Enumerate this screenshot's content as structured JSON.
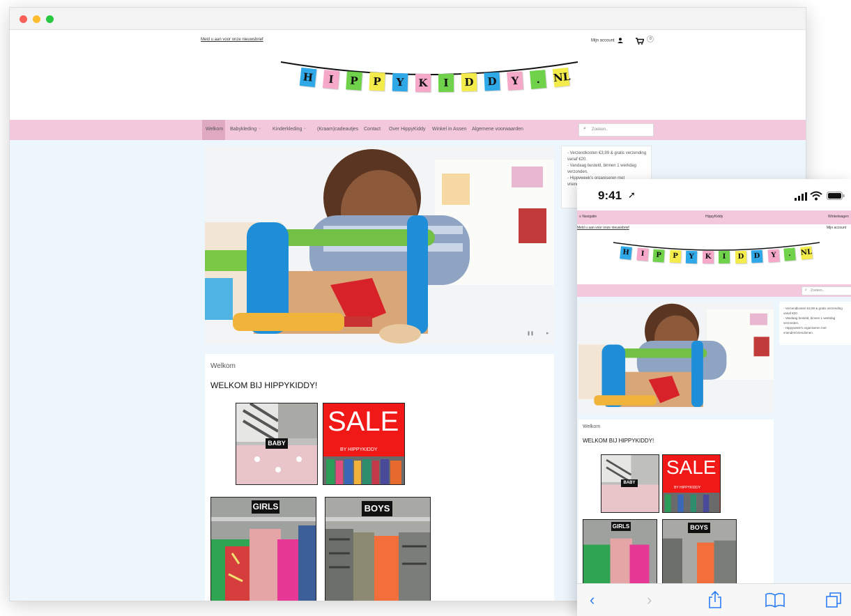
{
  "desktop": {
    "newsletter_link": "Meld u aan voor onze nieuwsbrief",
    "account_label": "Mijn account",
    "cart_count": "0",
    "logo_letters": [
      "H",
      "I",
      "P",
      "P",
      "Y",
      "K",
      "I",
      "D",
      "D",
      "Y",
      ".",
      "NL"
    ],
    "nav": {
      "items": [
        "Welkom",
        "Babykleding",
        "Kinderkleding",
        "(Kraam)cadeautjes",
        "Contact",
        "Over HippyKiddy",
        "Winkel in Assen",
        "Algemene voorwaarden"
      ],
      "active": "Welkom"
    },
    "search_placeholder": "Zoeken..",
    "info_box": [
      "- Verzendkosten €3,99 & gratis verzending vanaf €20.",
      "- Vandaag besteld, binnen 1 werkdag verzonden.",
      "- Hippyweek's organiseren met vrienden/vriendinnen."
    ],
    "content": {
      "breadcrumb": "Welkom",
      "heading": "WELKOM BIJ HIPPYKIDDY!",
      "tiles": [
        "BABY",
        "SALE",
        "BY HIPPYKIDDY",
        "GIRLS",
        "BOYS"
      ]
    }
  },
  "mobile": {
    "time": "9:41",
    "nav_left": "Navigatie",
    "nav_center": "HippyKiddy",
    "nav_right": "Winkelwagen",
    "newsletter_link": "Meld u aan voor onze nieuwsbrief",
    "account_label": "Mijn account",
    "search_placeholder": "Zoeken..",
    "info_box": [
      "- Verzendkosten €3,99 & gratis verzending vanaf €20.",
      "- Vandaag besteld, binnen 1 werkdag verzonden.",
      "- Hippyweek's organiseren met vrienden/vriendinnen."
    ],
    "breadcrumb": "Welkom",
    "heading": "WELKOM BIJ HIPPYKIDDY!"
  },
  "colors": {
    "nav_pink": "#f3c7dc",
    "page_bg": "#eef6fd",
    "sale_red": "#f11818",
    "ios_blue": "#2a7cf6"
  }
}
